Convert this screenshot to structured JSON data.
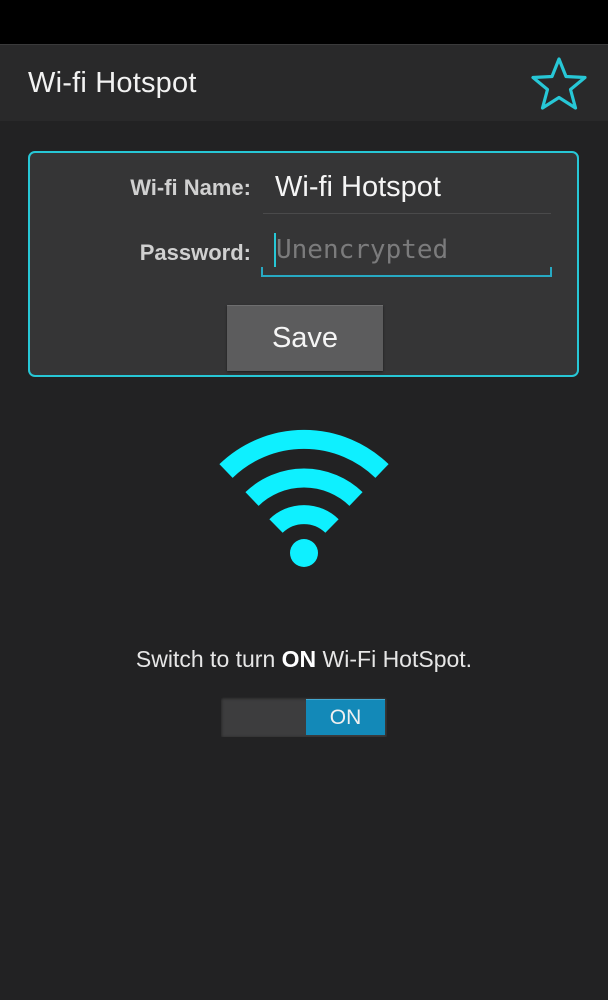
{
  "action_bar": {
    "title": "Wi-fi Hotspot",
    "favorite_icon": "star-outline-icon"
  },
  "form": {
    "name_label": "Wi-fi Name:",
    "name_value": "Wi-fi Hotspot",
    "password_label": "Password:",
    "password_value": "",
    "password_placeholder": "Unencrypted",
    "save_label": "Save"
  },
  "hotspot": {
    "icon": "wifi-icon",
    "prompt_prefix": "Switch to turn ",
    "prompt_bold": "ON",
    "prompt_suffix": " Wi-Fi HotSpot.",
    "toggle_label": "ON",
    "toggle_state": true
  },
  "colors": {
    "accent": "#27c7d6",
    "wifi": "#0ef0ff",
    "toggle_on": "#1389b8",
    "background": "#222223"
  }
}
